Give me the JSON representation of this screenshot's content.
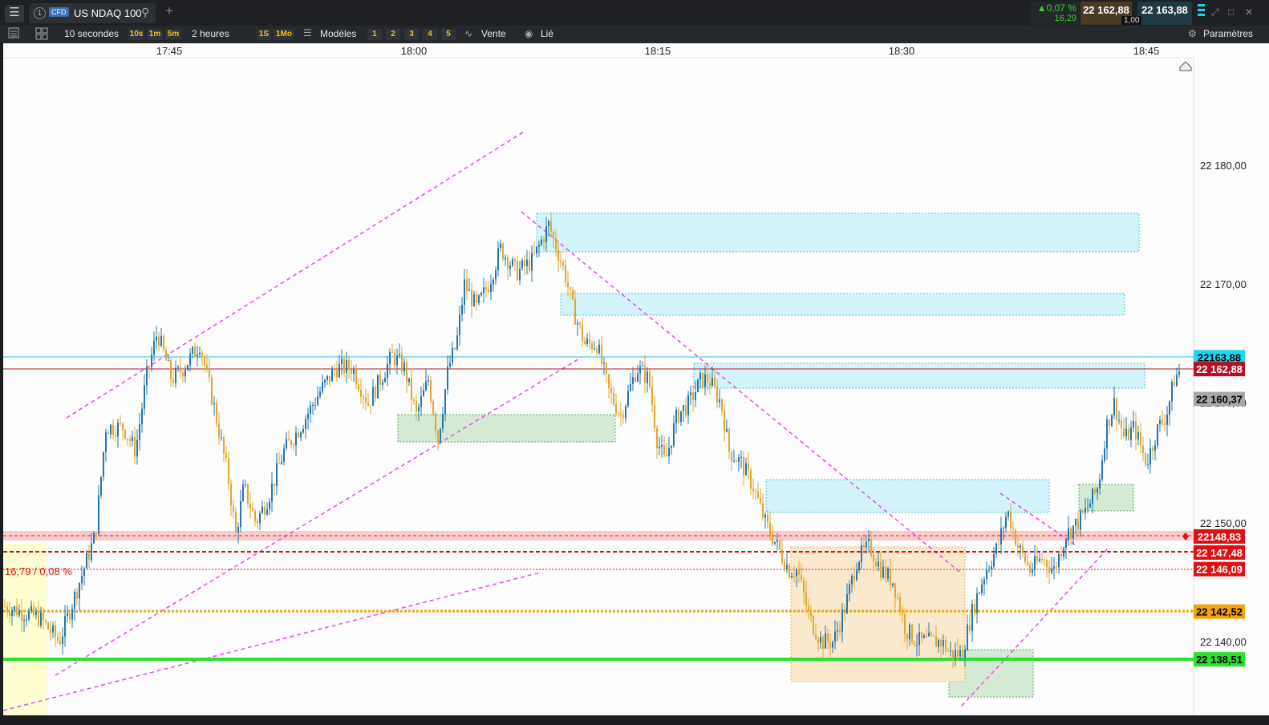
{
  "topbar": {
    "menu_icon": "hamburger-icon",
    "tab_number": "1",
    "tab_badge": "CFD",
    "instrument": "US NDAQ 100",
    "change_pct": "▲0,07 %",
    "change_pts": "16,29",
    "bid_price": "22 162,88",
    "ask_price": "22 163,88",
    "spread": "1,00"
  },
  "toolbar": {
    "period_label": "10 secondes",
    "quick_periods": [
      "10s",
      "1m",
      "5m"
    ],
    "range_label": "2 heures",
    "range_buttons": [
      "1S",
      "1Mo"
    ],
    "templates_label": "Modèles",
    "layout_buttons": [
      "1",
      "2",
      "3",
      "4",
      "5"
    ],
    "sell_label": "Vente",
    "linked_label": "Lié",
    "settings_label": "Paramètres"
  },
  "chart_data": {
    "type": "candlestick",
    "x_ticks": [
      "17:45",
      "18:00",
      "18:15",
      "18:30",
      "18:45"
    ],
    "y_ticks": [
      "22 180,00",
      "22 170,00",
      "22 160,00",
      "22 150,00",
      "22 140,00"
    ],
    "ylim": [
      22135.5,
      22190
    ],
    "colors": {
      "up": "#1f77b4",
      "down": "#e3a52a"
    },
    "last_close": 22162.88,
    "price_tags": [
      {
        "label": "22163,88",
        "value": 22163.88,
        "color": "#1ad8f5",
        "text_color": "#000000"
      },
      {
        "label": "22 162,88",
        "value": 22162.88,
        "color": "#b31020",
        "text_color": "#ffffff"
      },
      {
        "label": "22 160,37",
        "value": 22160.37,
        "color": "#a8a8a8",
        "text_color": "#000000"
      },
      {
        "label": "22148,83",
        "value": 22148.83,
        "color": "#e01010",
        "text_color": "#ffffff"
      },
      {
        "label": "22 147,48",
        "value": 22147.48,
        "color": "#e01010",
        "text_color": "#ffffff"
      },
      {
        "label": "22 146,09",
        "value": 22146.09,
        "color": "#e01010",
        "text_color": "#ffffff"
      },
      {
        "label": "22 142,52",
        "value": 22142.52,
        "color": "#f5a20c",
        "text_color": "#000000"
      },
      {
        "label": "22 138,51",
        "value": 22138.51,
        "color": "#2ee02e",
        "text_color": "#000000"
      }
    ],
    "annotation": "16,79 / 0,08 %"
  }
}
